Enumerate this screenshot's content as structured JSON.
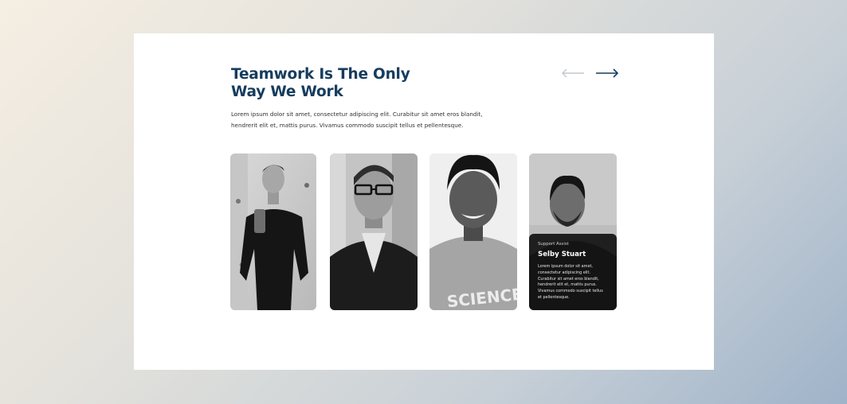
{
  "section": {
    "title_line1": "Teamwork Is The Only",
    "title_line2": "Way We Work",
    "description": "Lorem ipsum dolor sit amet, consectetur adipiscing elit. Curabitur sit amet eros blandit, hendrerit elit et, mattis purus. Vivamus commodo suscipit tellus et pellentesque."
  },
  "nav": {
    "prev_icon": "arrow-left-icon",
    "next_icon": "arrow-right-icon",
    "prev_color": "#c4c9ce",
    "next_color": "#163c5e"
  },
  "team": [
    {
      "photo": "person-standing-photo"
    },
    {
      "photo": "person-glasses-photo"
    },
    {
      "photo": "person-smiling-photo"
    },
    {
      "photo": "person-beard-photo",
      "role": "Support Assist",
      "name": "Selby Stuart",
      "bio": "Lorem ipsum dolor sit amet, consectetur adipiscing elit. Curabitur sit amet eros blandit, hendrerit elit et, mattis purus. Vivamus commodo suscipit tellus et pellentesque."
    }
  ],
  "colors": {
    "heading": "#163c5e",
    "overlay": "#121212"
  }
}
